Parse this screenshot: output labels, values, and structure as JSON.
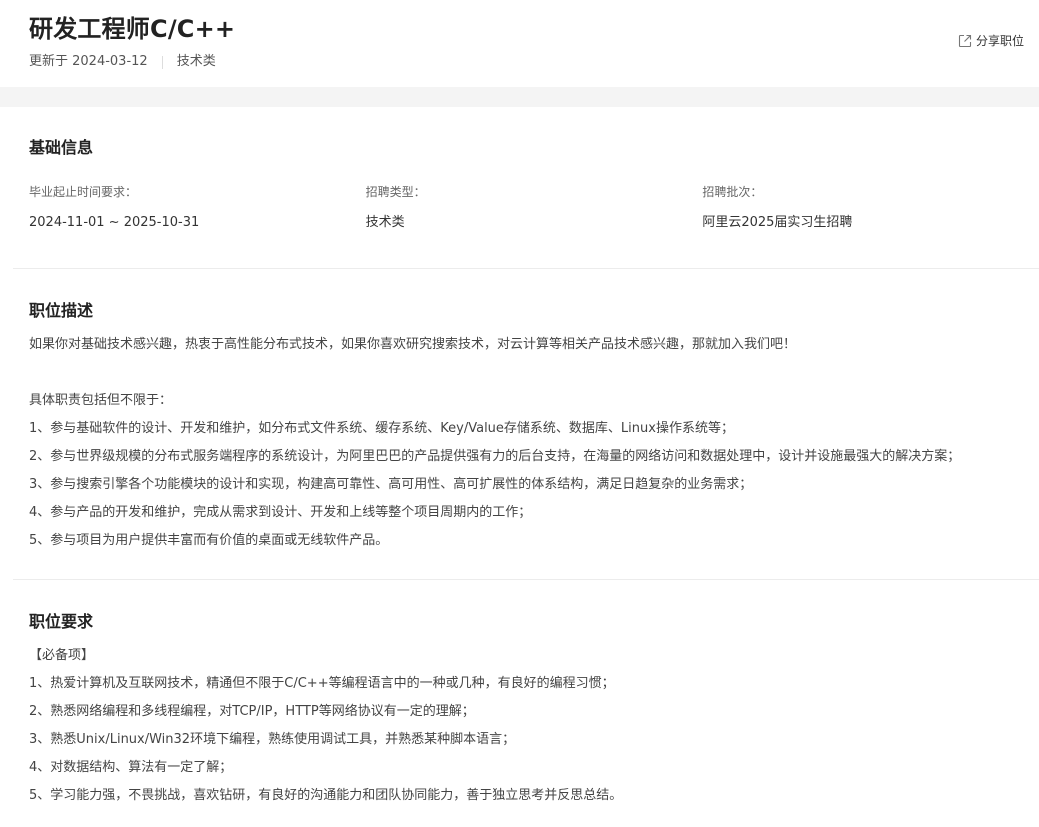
{
  "header": {
    "title": "研发工程师C/C++",
    "updated": "更新于 2024-03-12",
    "category": "技术类",
    "share_label": "分享职位",
    "share_icon": "share-external-icon"
  },
  "basic": {
    "title": "基础信息",
    "fields": [
      {
        "label": "毕业起止时间要求：",
        "value": "2024-11-01 ~ 2025-10-31"
      },
      {
        "label": "招聘类型：",
        "value": "技术类"
      },
      {
        "label": "招聘批次：",
        "value": "阿里云2025届实习生招聘"
      }
    ]
  },
  "description": {
    "title": "职位描述",
    "intro": "如果你对基础技术感兴趣，热衷于高性能分布式技术，如果你喜欢研究搜索技术，对云计算等相关产品技术感兴趣，那就加入我们吧！",
    "lead": "具体职责包括但不限于：",
    "items": [
      "1、参与基础软件的设计、开发和维护，如分布式文件系统、缓存系统、Key/Value存储系统、数据库、Linux操作系统等；",
      "2、参与世界级规模的分布式服务端程序的系统设计，为阿里巴巴的产品提供强有力的后台支持，在海量的网络访问和数据处理中，设计并设施最强大的解决方案；",
      "3、参与搜索引擎各个功能模块的设计和实现，构建高可靠性、高可用性、高可扩展性的体系结构，满足日趋复杂的业务需求；",
      "4、参与产品的开发和维护，完成从需求到设计、开发和上线等整个项目周期内的工作；",
      "5、参与项目为用户提供丰富而有价值的桌面或无线软件产品。"
    ]
  },
  "requirements": {
    "title": "职位要求",
    "lead": "【必备项】",
    "items": [
      "1、热爱计算机及互联网技术，精通但不限于C/C++等编程语言中的一种或几种，有良好的编程习惯；",
      "2、熟悉网络编程和多线程编程，对TCP/IP，HTTP等网络协议有一定的理解；",
      "3、熟悉Unix/Linux/Win32环境下编程，熟练使用调试工具，并熟悉某种脚本语言；",
      "4、对数据结构、算法有一定了解；",
      "5、学习能力强，不畏挑战，喜欢钻研，有良好的沟通能力和团队协同能力，善于独立思考并反思总结。"
    ]
  }
}
